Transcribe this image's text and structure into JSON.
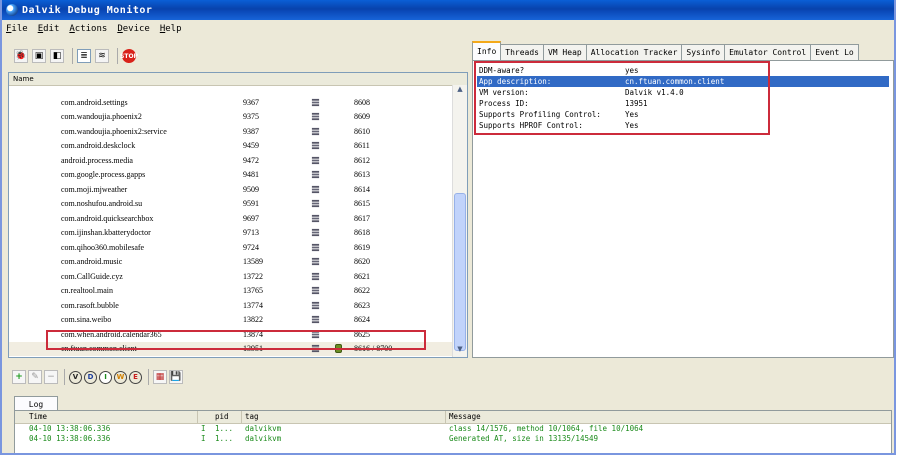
{
  "window": {
    "title": "Dalvik Debug Monitor"
  },
  "menu": [
    {
      "label": "File",
      "u": "F",
      "rest": "ile"
    },
    {
      "label": "Edit",
      "u": "E",
      "rest": "dit"
    },
    {
      "label": "Actions",
      "u": "A",
      "rest": "ctions"
    },
    {
      "label": "Device",
      "u": "D",
      "rest": "evice"
    },
    {
      "label": "Help",
      "u": "H",
      "rest": "elp"
    }
  ],
  "devices": {
    "column_header": "Name",
    "processes": [
      {
        "name": "com.android.settings",
        "pid": "9367",
        "port": "8608"
      },
      {
        "name": "com.wandoujia.phoenix2",
        "pid": "9375",
        "port": "8609"
      },
      {
        "name": "com.wandoujia.phoenix2:service",
        "pid": "9387",
        "port": "8610"
      },
      {
        "name": "com.android.deskclock",
        "pid": "9459",
        "port": "8611"
      },
      {
        "name": "android.process.media",
        "pid": "9472",
        "port": "8612"
      },
      {
        "name": "com.google.process.gapps",
        "pid": "9481",
        "port": "8613"
      },
      {
        "name": "com.moji.mjweather",
        "pid": "9509",
        "port": "8614"
      },
      {
        "name": "com.noshufou.android.su",
        "pid": "9591",
        "port": "8615"
      },
      {
        "name": "com.android.quicksearchbox",
        "pid": "9697",
        "port": "8617"
      },
      {
        "name": "com.ijinshan.kbatterydoctor",
        "pid": "9713",
        "port": "8618"
      },
      {
        "name": "com.qihoo360.mobilesafe",
        "pid": "9724",
        "port": "8619"
      },
      {
        "name": "com.android.music",
        "pid": "13589",
        "port": "8620"
      },
      {
        "name": "com.CallGuide.cyz",
        "pid": "13722",
        "port": "8621"
      },
      {
        "name": "cn.realtool.main",
        "pid": "13765",
        "port": "8622"
      },
      {
        "name": "com.rasoft.bubble",
        "pid": "13774",
        "port": "8623"
      },
      {
        "name": "com.sina.weibo",
        "pid": "13822",
        "port": "8624"
      },
      {
        "name": "com.when.android.calendar365",
        "pid": "13874",
        "port": "8625"
      },
      {
        "name": "cn.ftuan.common.client",
        "pid": "13951",
        "port": "8616 / 8700",
        "selected": true
      }
    ]
  },
  "tabs": [
    "Info",
    "Threads",
    "VM Heap",
    "Allocation Tracker",
    "Sysinfo",
    "Emulator Control",
    "Event Lo"
  ],
  "info": [
    {
      "key": "DDM-aware?",
      "value": "yes"
    },
    {
      "key": "App description:",
      "value": "cn.ftuan.common.client",
      "selected": true
    },
    {
      "key": "VM version:",
      "value": "Dalvik v1.4.0"
    },
    {
      "key": "Process ID:",
      "value": "13951"
    },
    {
      "key": "Supports Profiling Control:",
      "value": "Yes"
    },
    {
      "key": "Supports HPROF Control:",
      "value": "Yes"
    }
  ],
  "log": {
    "tab_label": "Log",
    "columns": {
      "time": "Time",
      "pid": "pid",
      "tag": "tag",
      "message": "Message"
    },
    "rows": [
      {
        "time": "04-10 13:38:06.336",
        "level": "I",
        "pid": "1...",
        "tag": "dalvikvm",
        "message": "class 14/1576, method 10/1064, file 10/1064"
      },
      {
        "time": "04-10 13:38:06.336",
        "level": "I",
        "pid": "1...",
        "tag": "dalvikvm",
        "message": "Generated AT, size in 13135/14549"
      }
    ]
  },
  "colors": {
    "highlight_red": "#cc2b3b",
    "selection_blue": "#316ac5",
    "log_text_green": "#1a8a1a"
  }
}
